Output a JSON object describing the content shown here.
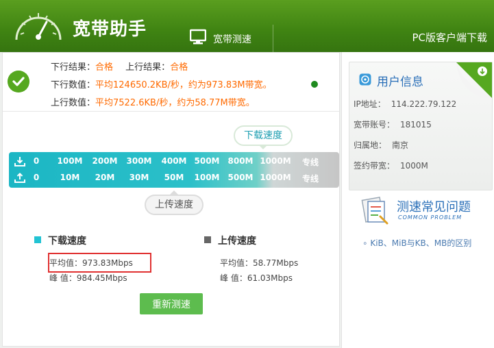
{
  "header": {
    "app_title": "宽带助手",
    "tab_speed_label": "宽带测速",
    "pc_download_label": "PC版客户端下载"
  },
  "result": {
    "down_result_label": "下行结果：",
    "down_result_value": "合格",
    "up_result_label": "上行结果：",
    "up_result_value": "合格",
    "down_value_label": "下行数值：",
    "down_value_text": "平均124650.2KB/秒，约为973.83M带宽。",
    "up_value_label": "上行数值：",
    "up_value_text": "平均7522.6KB/秒，约为58.77M带宽。"
  },
  "meter": {
    "down_bubble": "下载速度",
    "up_bubble": "上传速度",
    "down_ticks": [
      "0",
      "100M",
      "200M",
      "300M",
      "400M",
      "500M",
      "800M",
      "1000M",
      "专线"
    ],
    "up_ticks": [
      "0",
      "10M",
      "20M",
      "30M",
      "50M",
      "100M",
      "500M",
      "1000M",
      "专线"
    ]
  },
  "summary": {
    "download_title": "下载速度",
    "download_avg": "平均值：973.83Mbps",
    "download_peak": "峰 值：984.45Mbps",
    "upload_title": "上传速度",
    "upload_avg": "平均值：58.77Mbps",
    "upload_peak": "峰 值：61.03Mbps",
    "retest_label": "重新测速"
  },
  "user_info": {
    "title": "用户信息",
    "ip_label": "IP地址：",
    "ip_value": "114.222.79.122",
    "account_label": "宽带账号：",
    "account_value": "181015",
    "location_label": "归属地：",
    "location_value": "南京",
    "bandwidth_label": "签约带宽：",
    "bandwidth_value": "1000M"
  },
  "faq": {
    "title": "测速常见问题",
    "subtitle": "COMMON PROBLEM",
    "link": "KiB、MiB与KB、MB的区别"
  },
  "colors": {
    "header_green": "#3f8312",
    "accent_orange": "#ff6a00",
    "meter_teal": "#1bb6c4",
    "info_blue": "#2a6fb8",
    "retest_green": "#5dbc4e",
    "highlight_red": "#e03030"
  }
}
